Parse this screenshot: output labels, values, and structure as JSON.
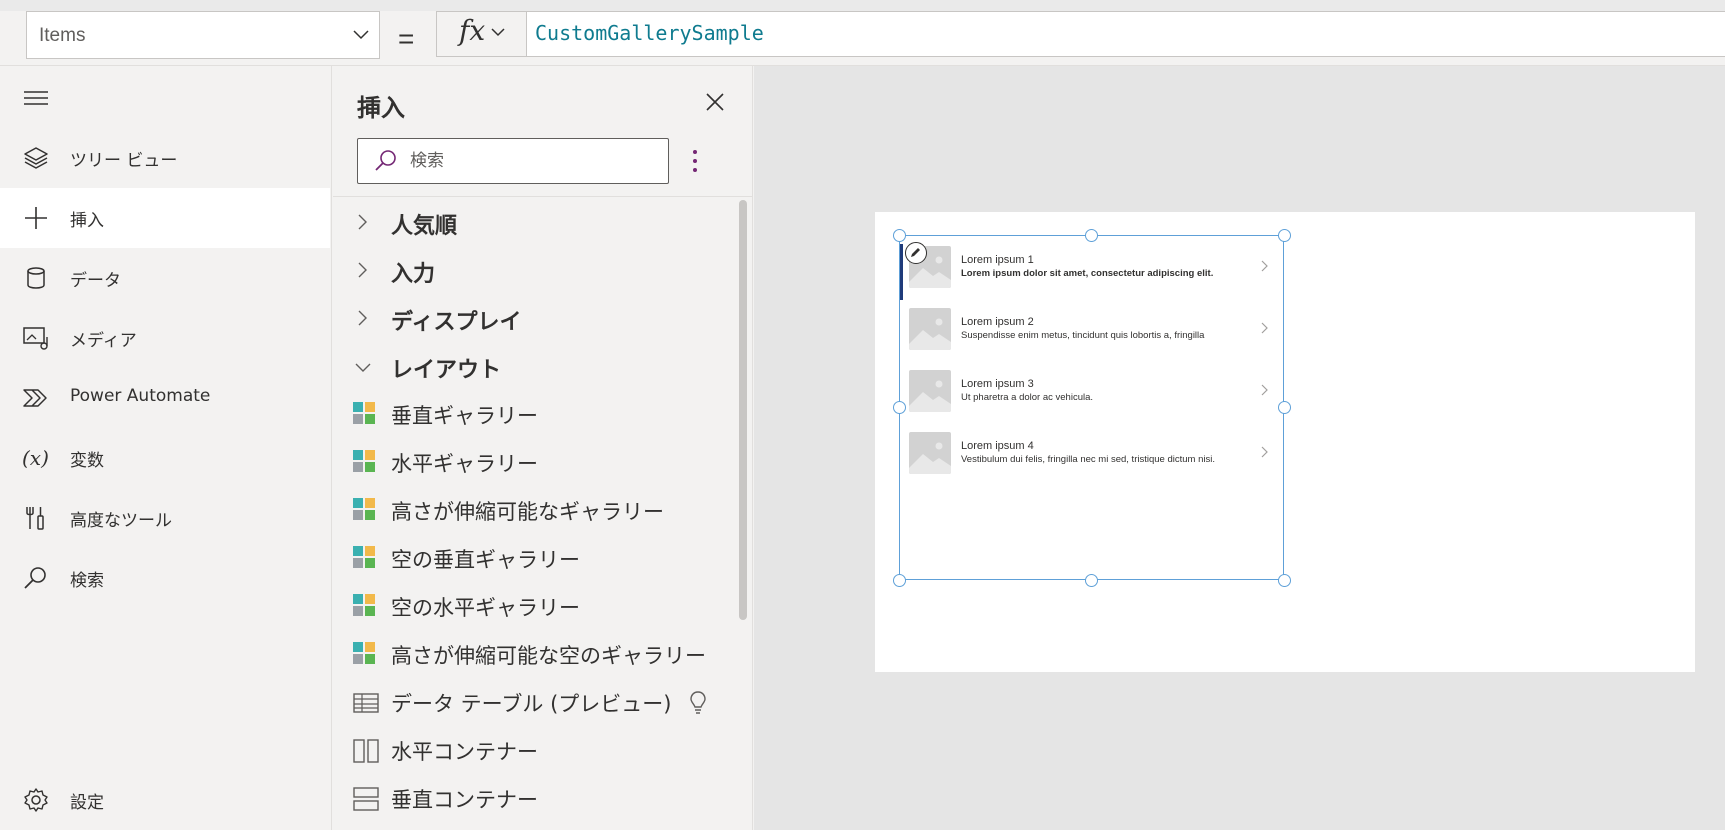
{
  "formula_bar": {
    "property": "Items",
    "equals": "=",
    "fx": "fx",
    "formula": "CustomGallerySample"
  },
  "left_nav": {
    "items": [
      {
        "label": "ツリー ビュー",
        "icon": "layers-icon"
      },
      {
        "label": "挿入",
        "icon": "plus-icon",
        "active": true
      },
      {
        "label": "データ",
        "icon": "database-icon"
      },
      {
        "label": "メディア",
        "icon": "media-icon"
      },
      {
        "label": "Power Automate",
        "icon": "power-automate-icon"
      },
      {
        "label": "変数",
        "icon": "variable-icon"
      },
      {
        "label": "高度なツール",
        "icon": "tools-icon"
      },
      {
        "label": "検索",
        "icon": "search-icon"
      }
    ],
    "settings": "設定"
  },
  "insert_pane": {
    "title": "挿入",
    "search_placeholder": "検索",
    "categories": [
      {
        "label": "人気順",
        "expanded": false
      },
      {
        "label": "入力",
        "expanded": false
      },
      {
        "label": "ディスプレイ",
        "expanded": false
      },
      {
        "label": "レイアウト",
        "expanded": true
      }
    ],
    "controls": [
      {
        "label": "垂直ギャラリー",
        "icon": "gallery-icon"
      },
      {
        "label": "水平ギャラリー",
        "icon": "gallery-icon"
      },
      {
        "label": "高さが伸縮可能なギャラリー",
        "icon": "gallery-icon"
      },
      {
        "label": "空の垂直ギャラリー",
        "icon": "gallery-icon"
      },
      {
        "label": "空の水平ギャラリー",
        "icon": "gallery-icon"
      },
      {
        "label": "高さが伸縮可能な空のギャラリー",
        "icon": "gallery-icon"
      },
      {
        "label": "データ テーブル (プレビュー)",
        "icon": "table-icon"
      },
      {
        "label": "水平コンテナー",
        "icon": "horizontal-container-icon"
      },
      {
        "label": "垂直コンテナー",
        "icon": "vertical-container-icon"
      }
    ]
  },
  "gallery": {
    "items": [
      {
        "title": "Lorem ipsum 1",
        "subtitle": "Lorem ipsum dolor sit amet, consectetur adipiscing elit."
      },
      {
        "title": "Lorem ipsum 2",
        "subtitle": "Suspendisse enim metus, tincidunt quis lobortis a, fringilla"
      },
      {
        "title": "Lorem ipsum 3",
        "subtitle": "Ut pharetra a dolor ac vehicula."
      },
      {
        "title": "Lorem ipsum 4",
        "subtitle": "Vestibulum dui felis, fringilla nec mi sed, tristique dictum nisi."
      }
    ]
  },
  "colors": {
    "accent": "#742774",
    "formula_text": "#0f7b8f",
    "selection": "#5ea0d8"
  }
}
